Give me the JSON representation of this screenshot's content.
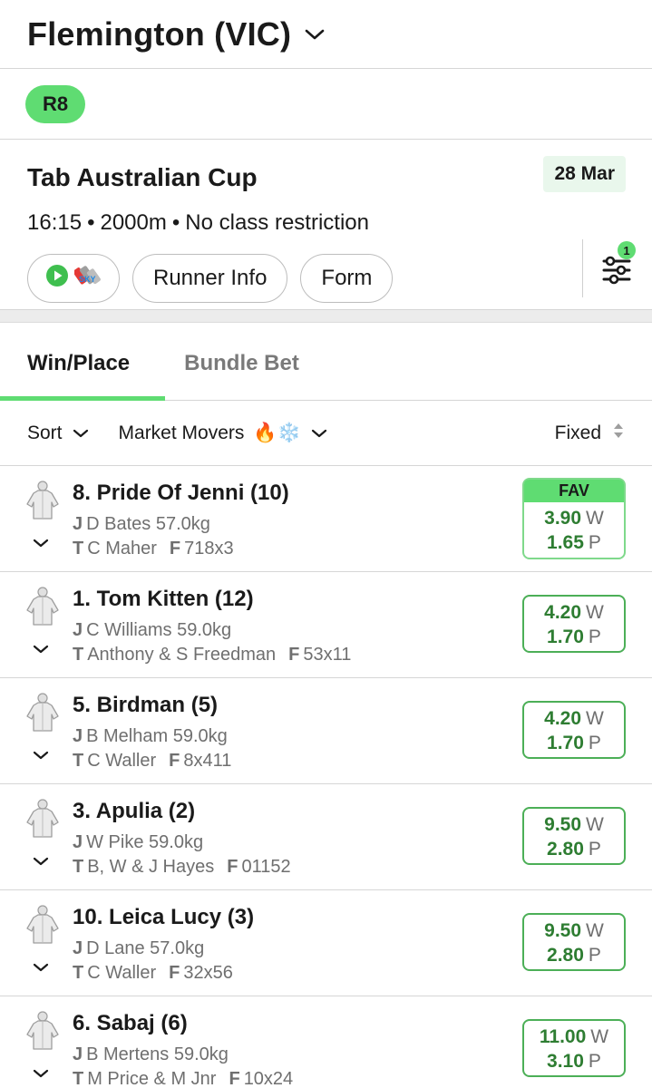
{
  "header": {
    "venue": "Flemington (VIC)"
  },
  "race": {
    "number": "R8",
    "title": "Tab Australian Cup",
    "date": "28 Mar",
    "time": "16:15",
    "distance": "2000m",
    "class": "No class restriction",
    "stream_icons": [
      "play-icon",
      "sky-racing-icon"
    ],
    "chips": {
      "runner_info": "Runner Info",
      "form": "Form"
    },
    "filter_badge": "1"
  },
  "tabs": {
    "win_place": "Win/Place",
    "bundle_bet": "Bundle Bet"
  },
  "filters": {
    "sort": "Sort",
    "market_movers": "Market Movers",
    "market_movers_icons": "🔥❄️",
    "price_type": "Fixed"
  },
  "colors": {
    "accent": "#5fdc72",
    "odds_text": "#2e7d32",
    "odds_border": "#4caf57",
    "badge_bg": "#e9f7ec"
  },
  "runners": [
    {
      "name": "8. Pride Of Jenni (10)",
      "jockey_label": "J",
      "jockey": "D Bates 57.0kg",
      "trainer_label": "T",
      "trainer": "C Maher",
      "form_label": "F",
      "form": "718x3",
      "fav": "FAV",
      "win": "3.90",
      "win_unit": "W",
      "place": "1.65",
      "place_unit": "P"
    },
    {
      "name": "1. Tom Kitten (12)",
      "jockey_label": "J",
      "jockey": "C Williams 59.0kg",
      "trainer_label": "T",
      "trainer": "Anthony & S Freedman",
      "form_label": "F",
      "form": "53x11",
      "win": "4.20",
      "win_unit": "W",
      "place": "1.70",
      "place_unit": "P"
    },
    {
      "name": "5. Birdman (5)",
      "jockey_label": "J",
      "jockey": "B Melham 59.0kg",
      "trainer_label": "T",
      "trainer": "C Waller",
      "form_label": "F",
      "form": "8x411",
      "win": "4.20",
      "win_unit": "W",
      "place": "1.70",
      "place_unit": "P"
    },
    {
      "name": "3. Apulia (2)",
      "jockey_label": "J",
      "jockey": "W Pike 59.0kg",
      "trainer_label": "T",
      "trainer": "B, W & J Hayes",
      "form_label": "F",
      "form": "01152",
      "win": "9.50",
      "win_unit": "W",
      "place": "2.80",
      "place_unit": "P"
    },
    {
      "name": "10. Leica Lucy (3)",
      "jockey_label": "J",
      "jockey": "D Lane 57.0kg",
      "trainer_label": "T",
      "trainer": "C Waller",
      "form_label": "F",
      "form": "32x56",
      "win": "9.50",
      "win_unit": "W",
      "place": "2.80",
      "place_unit": "P"
    },
    {
      "name": "6. Sabaj (6)",
      "jockey_label": "J",
      "jockey": "B Mertens 59.0kg",
      "trainer_label": "T",
      "trainer": "M Price & M Jnr",
      "form_label": "F",
      "form": "10x24",
      "win": "11.00",
      "win_unit": "W",
      "place": "3.10",
      "place_unit": "P"
    }
  ]
}
